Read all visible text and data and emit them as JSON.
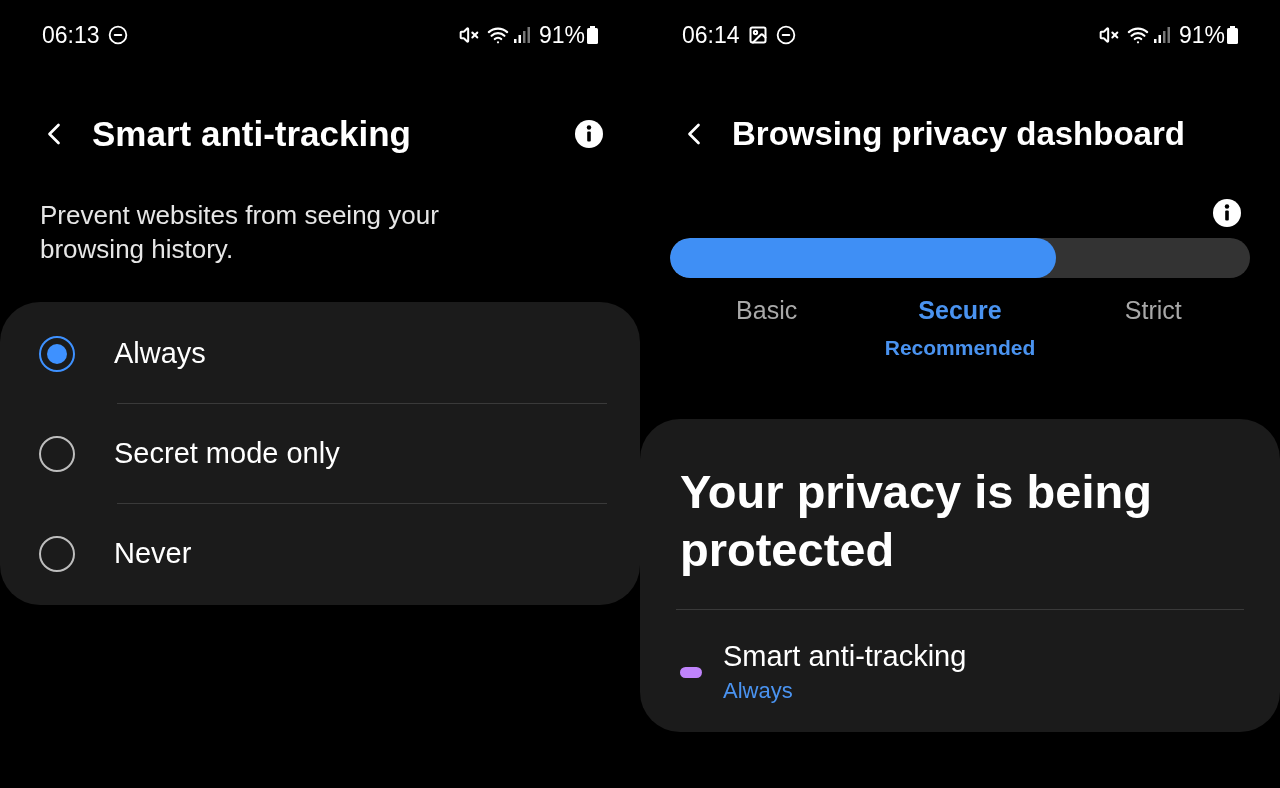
{
  "anti_tracking_screen": {
    "status_bar": {
      "time": "06:13",
      "notification_icons": [
        {
          "kind": "dnd"
        }
      ],
      "battery": "91%"
    },
    "title": "Smart anti-tracking",
    "description": "Prevent websites from seeing your browsing history.",
    "options": [
      {
        "label": "Always",
        "selected": true
      },
      {
        "label": "Secret mode only",
        "selected": false
      },
      {
        "label": "Never",
        "selected": false
      }
    ]
  },
  "dashboard_screen": {
    "status_bar": {
      "time": "06:14",
      "notification_icons": [
        {
          "kind": "image"
        },
        {
          "kind": "dnd"
        }
      ],
      "battery": "91%"
    },
    "title": "Browsing privacy dashboard",
    "privacy_level": {
      "level": 0.665,
      "steps": [
        {
          "label": "Basic",
          "selected": false
        },
        {
          "label": "Secure",
          "selected": true,
          "note": "Recommended"
        },
        {
          "label": "Strict",
          "selected": false
        }
      ]
    },
    "status_card": {
      "heading": "Your privacy is being protected",
      "features": [
        {
          "name": "Smart anti-tracking",
          "value": "Always",
          "color": "#c084fc"
        }
      ]
    }
  }
}
